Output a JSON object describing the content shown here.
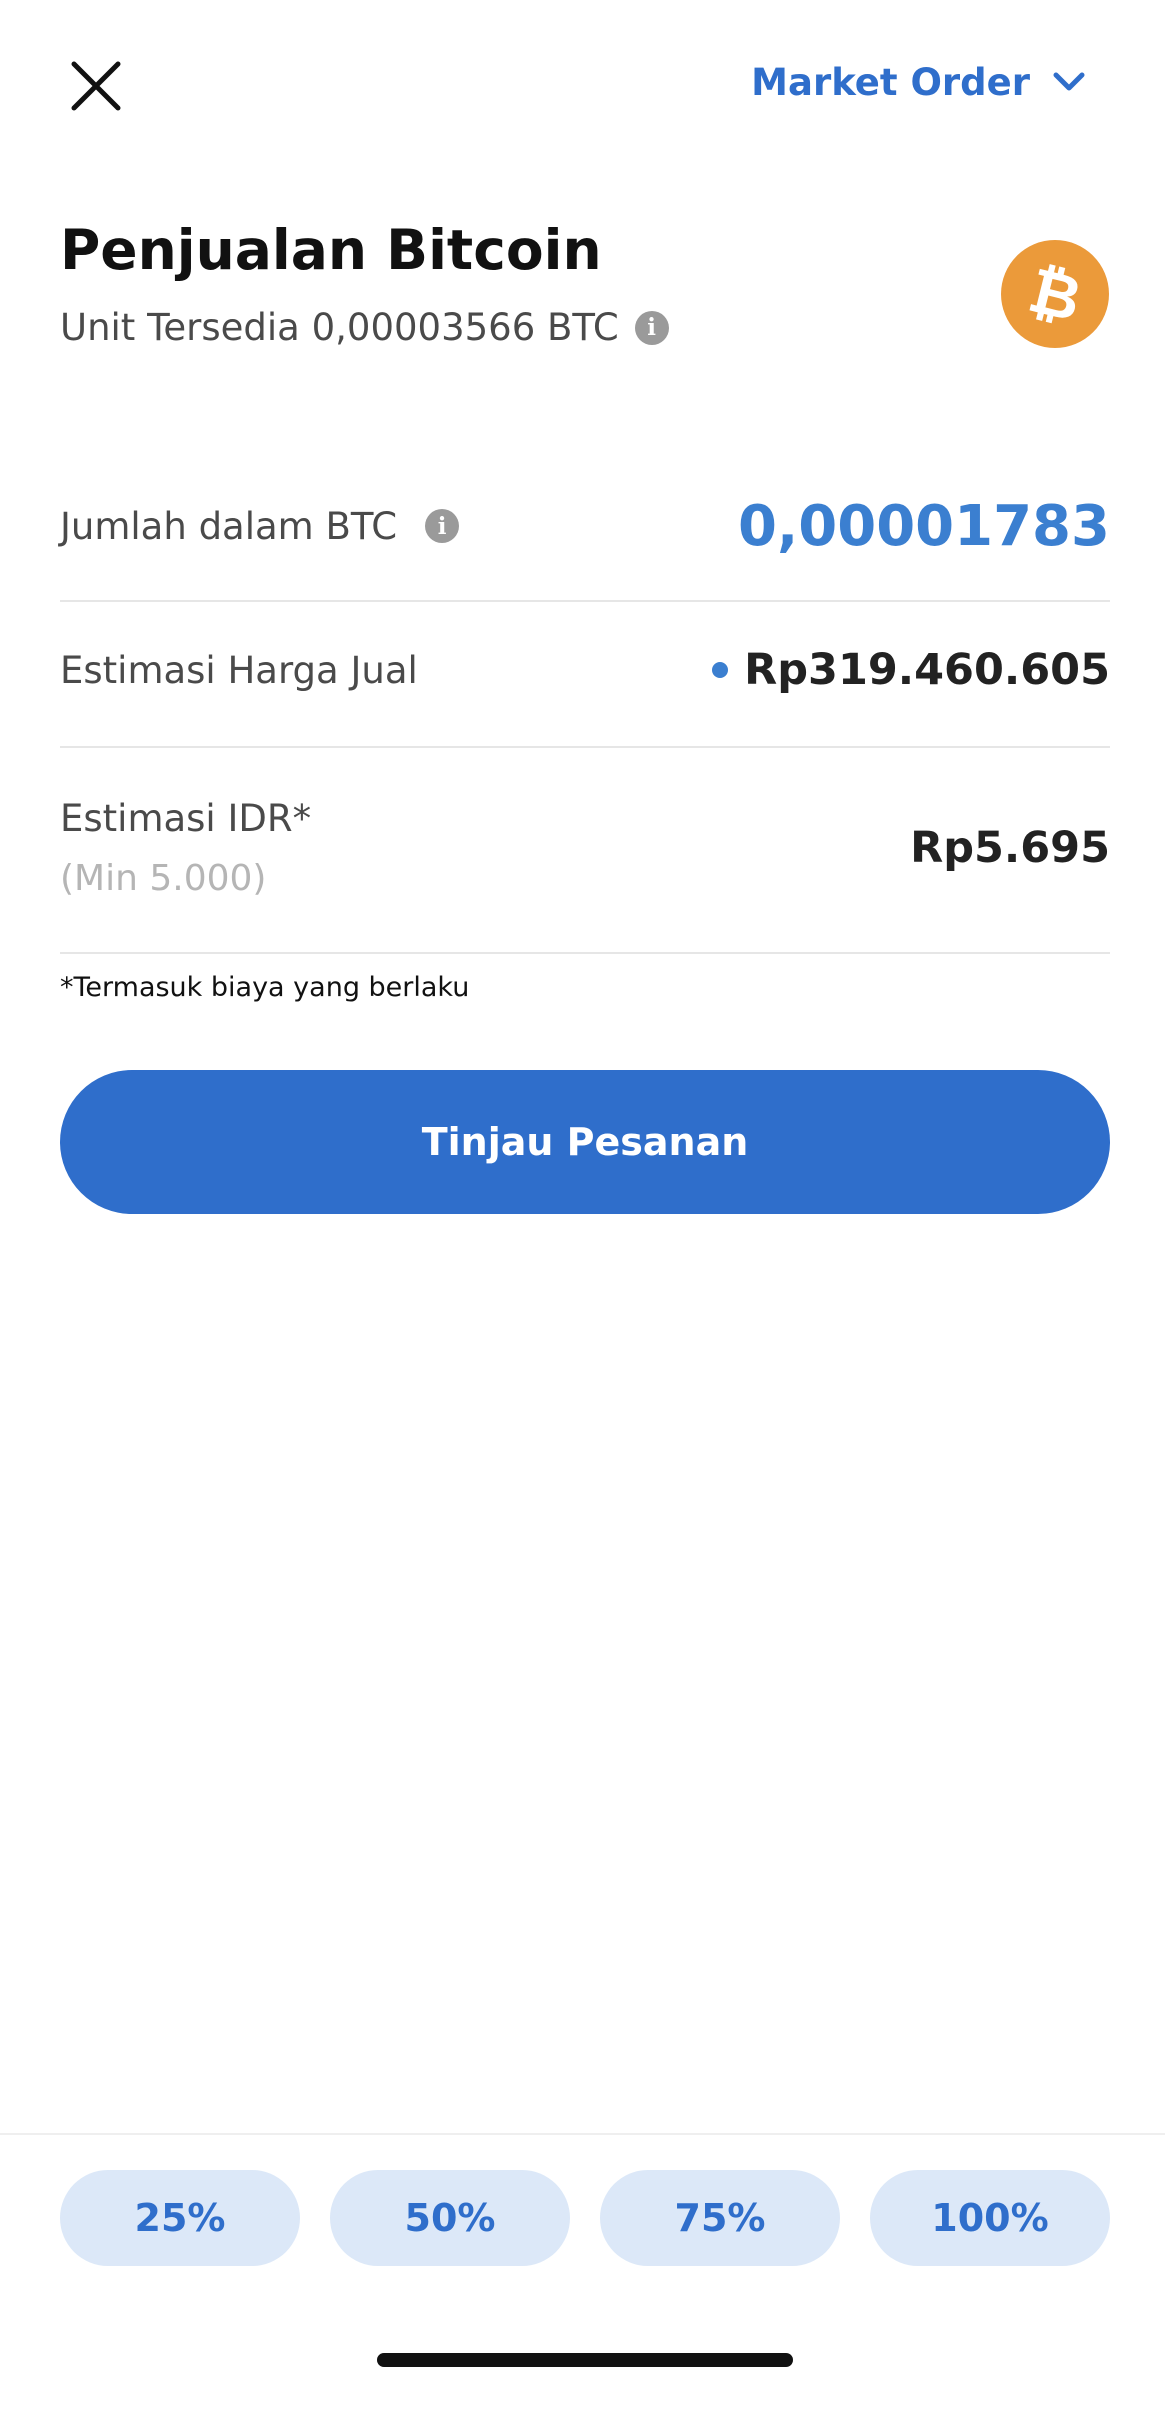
{
  "header": {
    "order_type": "Market Order",
    "close_icon": "close-icon",
    "chevron_icon": "chevron-down-icon"
  },
  "title": "Penjualan Bitcoin",
  "available_units": "Unit Tersedia 0,00003566 BTC",
  "coin": {
    "symbol_glyph": "₿",
    "icon": "bitcoin-logo",
    "color": "#eb9a3a"
  },
  "amount": {
    "label": "Jumlah dalam BTC",
    "value": "0,00001783"
  },
  "sell_price": {
    "label": "Estimasi Harga Jual",
    "value": "Rp319.460.605"
  },
  "idr_estimate": {
    "label": "Estimasi IDR*",
    "min": "(Min 5.000)",
    "value": "Rp5.695"
  },
  "footnote": "*Termasuk biaya yang berlaku",
  "review_button": "Tinjau Pesanan",
  "percent_options": [
    "25%",
    "50%",
    "75%",
    "100%"
  ],
  "colors": {
    "accent": "#2f6ecb",
    "accent_light": "#dce8f8",
    "amount_blue": "#3b7fd0"
  }
}
